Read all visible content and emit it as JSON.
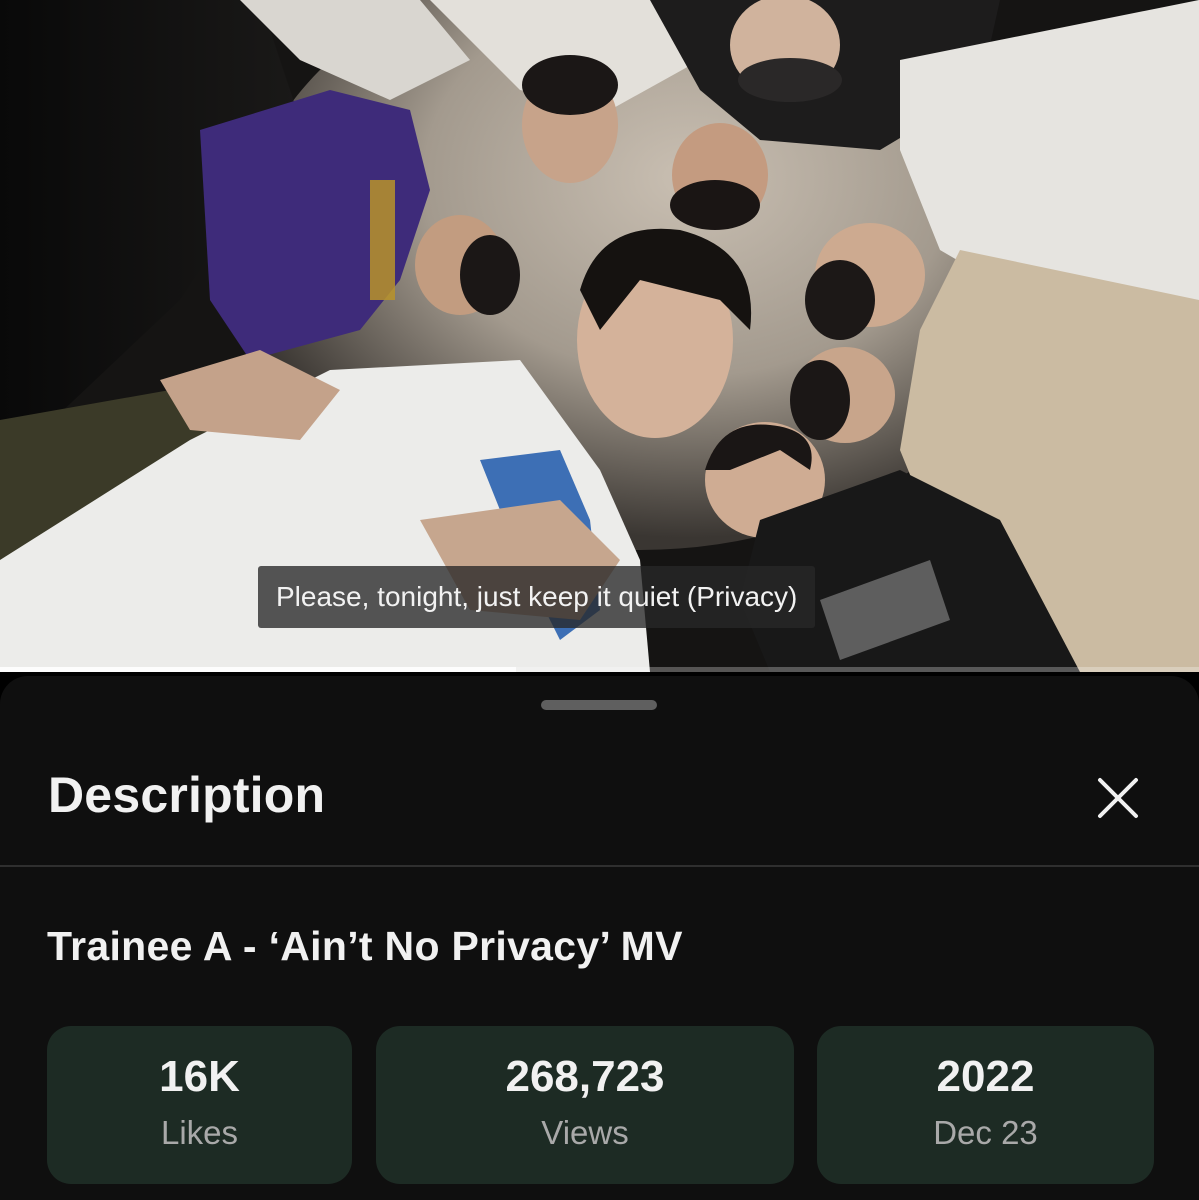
{
  "video": {
    "subtitle": "Please, tonight, just keep it quiet (Privacy)",
    "progress_fraction": 0.43
  },
  "sheet": {
    "title": "Description",
    "close_icon": "close-icon"
  },
  "description": {
    "video_title": "Trainee A - ‘Ain’t No Privacy’ MV",
    "stats": [
      {
        "value": "16K",
        "label": "Likes"
      },
      {
        "value": "268,723",
        "label": "Views"
      },
      {
        "value": "2022",
        "label": "Dec 23"
      }
    ]
  },
  "colors": {
    "sheet_background": "#0f0f0f",
    "stat_card_background": "#1d2b24",
    "primary_text": "#f1f1f1",
    "secondary_text": "#a9a9a9"
  }
}
